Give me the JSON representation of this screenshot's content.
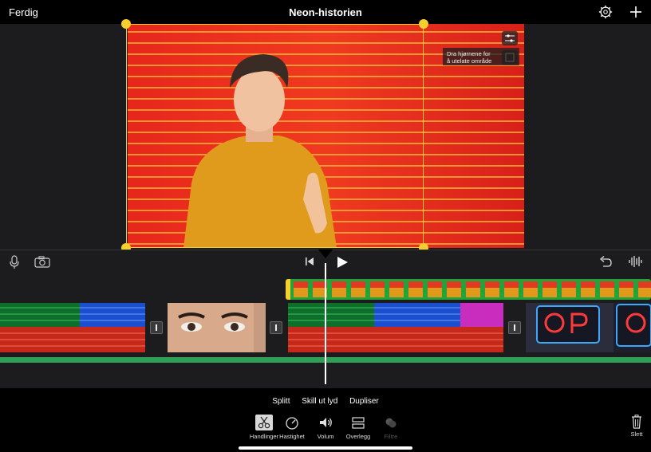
{
  "topbar": {
    "done_label": "Ferdig",
    "title": "Neon-historien",
    "settings_icon": "gear-icon",
    "add_icon": "plus-icon"
  },
  "viewer": {
    "hint_line1": "Dra hjørnene for",
    "hint_line2": "å utelate område"
  },
  "actions": {
    "links": [
      "Splitt",
      "Skill ut lyd",
      "Dupliser"
    ],
    "tools": [
      {
        "label": "Handlinger",
        "icon": "scissors-icon",
        "active": true
      },
      {
        "label": "Hastighet",
        "icon": "speedometer-icon",
        "active": false
      },
      {
        "label": "Volum",
        "icon": "speaker-icon",
        "active": false
      },
      {
        "label": "Overlegg",
        "icon": "overlay-icon",
        "active": false
      },
      {
        "label": "Filtre",
        "icon": "filters-icon",
        "disabled": true
      }
    ],
    "delete_label": "Slett"
  },
  "colors": {
    "accent_yellow": "#f5cf2b",
    "overlay_green": "#24a33b",
    "audio_green": "#2e9f55"
  }
}
